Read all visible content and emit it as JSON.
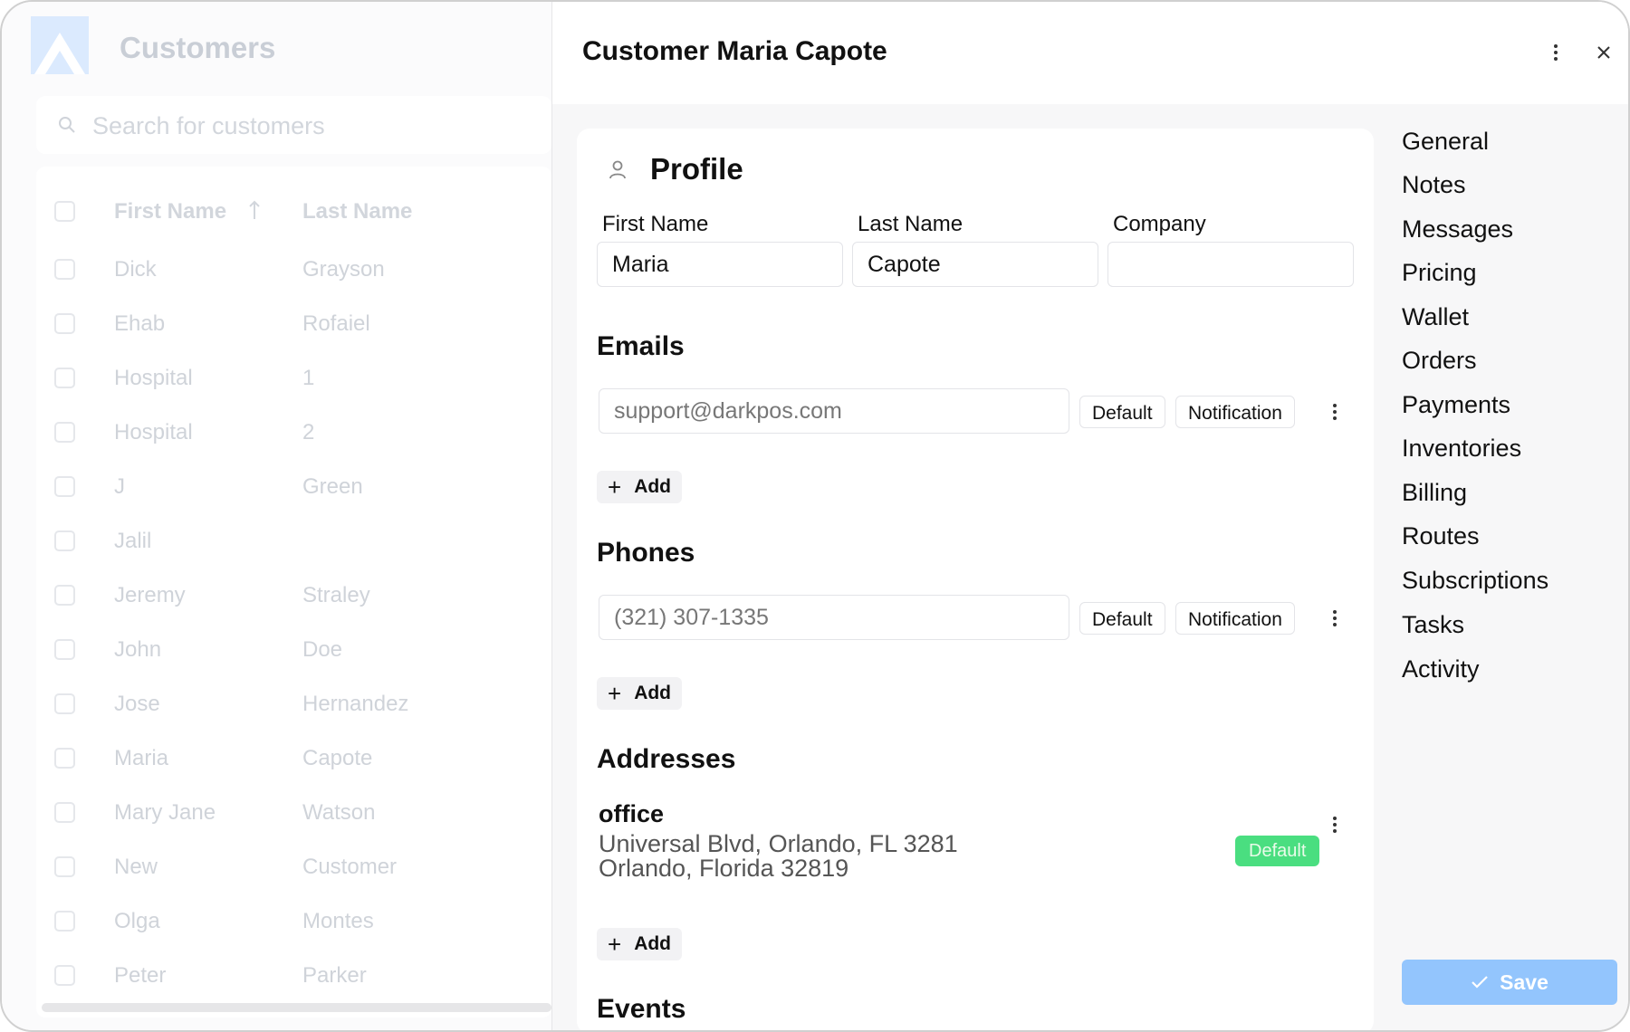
{
  "app": {
    "title": "Customers"
  },
  "search": {
    "placeholder": "Search for customers"
  },
  "table": {
    "columns": [
      "First Name",
      "Last Name"
    ],
    "rows": [
      [
        "Dick",
        "Grayson"
      ],
      [
        "Ehab",
        "Rofaiel"
      ],
      [
        "Hospital",
        "1"
      ],
      [
        "Hospital",
        "2"
      ],
      [
        "J",
        "Green"
      ],
      [
        "Jalil",
        ""
      ],
      [
        "Jeremy",
        "Straley"
      ],
      [
        "John",
        "Doe"
      ],
      [
        "Jose",
        "Hernandez"
      ],
      [
        "Maria",
        "Capote"
      ],
      [
        "Mary Jane",
        "Watson"
      ],
      [
        "New",
        "Customer"
      ],
      [
        "Olga",
        "Montes"
      ],
      [
        "Peter",
        "Parker"
      ]
    ]
  },
  "drawer": {
    "title": "Customer Maria Capote",
    "profile": {
      "title": "Profile",
      "first_name_label": "First Name",
      "last_name_label": "Last Name",
      "company_label": "Company",
      "first_name": "Maria",
      "last_name": "Capote",
      "company": ""
    },
    "emails": {
      "title": "Emails",
      "value": "support@darkpos.com",
      "default_label": "Default",
      "notification_label": "Notification",
      "add_label": "Add"
    },
    "phones": {
      "title": "Phones",
      "value": "(321) 307-1335",
      "default_label": "Default",
      "notification_label": "Notification",
      "add_label": "Add"
    },
    "addresses": {
      "title": "Addresses",
      "name": "office",
      "line1": "Universal Blvd, Orlando, FL 3281",
      "line2": "Orlando, Florida 32819",
      "badge": "Default",
      "add_label": "Add"
    },
    "events": {
      "title": "Events"
    },
    "nav": [
      "General",
      "Notes",
      "Messages",
      "Pricing",
      "Wallet",
      "Orders",
      "Payments",
      "Inventories",
      "Billing",
      "Routes",
      "Subscriptions",
      "Tasks",
      "Activity"
    ],
    "save_label": "Save"
  },
  "colors": {
    "save_button": "#93c5fd",
    "default_badge": "#4ade80",
    "logo": "#dbeafe"
  },
  "icons": [
    "logo-icon",
    "search-icon",
    "sort-arrow-up-icon",
    "more-vertical-icon",
    "close-icon",
    "user-icon",
    "plus-icon",
    "check-icon"
  ]
}
